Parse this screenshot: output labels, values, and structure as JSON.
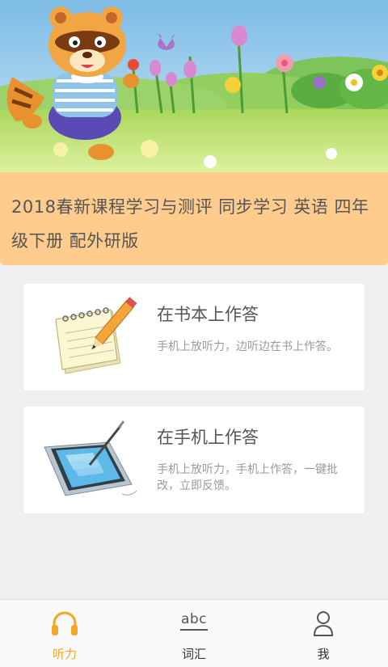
{
  "book": {
    "title": "2018春新课程学习与测评 同步学习 英语 四年级下册 配外研版"
  },
  "options": [
    {
      "title": "在书本上作答",
      "description": "手机上放听力，边听边在书上作答。"
    },
    {
      "title": "在手机上作答",
      "description": "手机上放听力，手机上作答，一键批改，立即反馈。"
    }
  ],
  "tabbar": {
    "active": "listen",
    "accent_color": "#f5a623",
    "items": [
      {
        "id": "listen",
        "label": "听力",
        "icon": "headphones-icon"
      },
      {
        "id": "vocab",
        "label": "词汇",
        "icon": "abc-icon",
        "icon_text": "abc"
      },
      {
        "id": "me",
        "label": "我",
        "icon": "person-icon"
      }
    ]
  },
  "colors": {
    "banner": "#ffcc8d",
    "background": "#efefef"
  }
}
